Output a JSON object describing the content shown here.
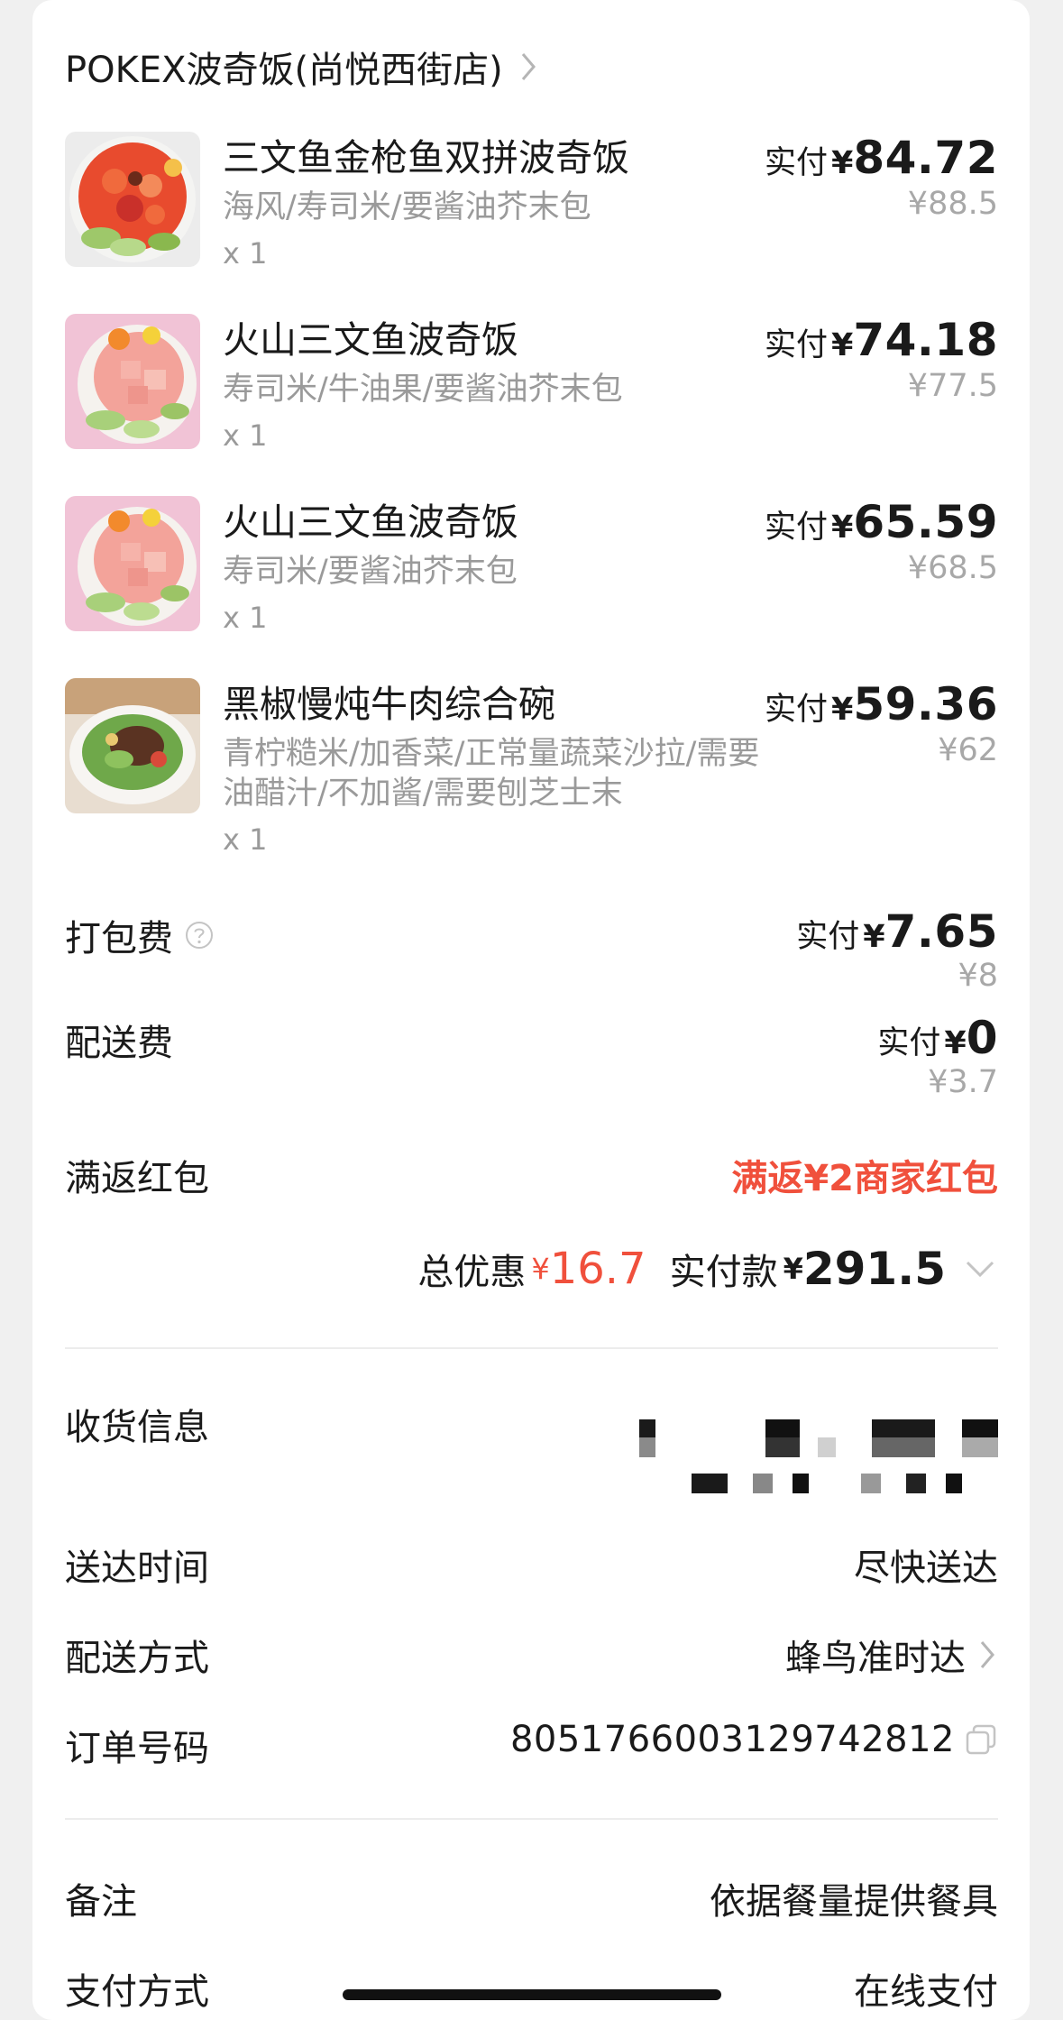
{
  "store": {
    "name": "POKEX波奇饭(尚悦西街店)"
  },
  "items": [
    {
      "name": "三文鱼金枪鱼双拼波奇饭",
      "spec": "海风/寿司米/要酱油芥末包",
      "qty": "x 1",
      "paid_label": "实付",
      "currency": "¥",
      "paid": "84.72",
      "original": "¥88.5",
      "image": "salmon-tuna-poke-bowl"
    },
    {
      "name": "火山三文鱼波奇饭",
      "spec": "寿司米/牛油果/要酱油芥末包",
      "qty": "x 1",
      "paid_label": "实付",
      "currency": "¥",
      "paid": "74.18",
      "original": "¥77.5",
      "image": "volcano-salmon-poke-bowl"
    },
    {
      "name": "火山三文鱼波奇饭",
      "spec": "寿司米/要酱油芥末包",
      "qty": "x 1",
      "paid_label": "实付",
      "currency": "¥",
      "paid": "65.59",
      "original": "¥68.5",
      "image": "volcano-salmon-poke-bowl"
    },
    {
      "name": "黑椒慢炖牛肉综合碗",
      "spec": "青柠糙米/加香菜/正常量蔬菜沙拉/需要油醋汁/不加酱/需要刨芝士末",
      "qty": "x 1",
      "paid_label": "实付",
      "currency": "¥",
      "paid": "59.36",
      "original": "¥62",
      "image": "black-pepper-beef-bowl"
    }
  ],
  "packing_fee": {
    "label": "打包费",
    "paid_label": "实付",
    "currency": "¥",
    "paid": "7.65",
    "original": "¥8"
  },
  "delivery_fee": {
    "label": "配送费",
    "paid_label": "实付",
    "currency": "¥",
    "paid": "0",
    "original": "¥3.7"
  },
  "red_packet": {
    "label": "满返红包",
    "value": "满返¥2商家红包"
  },
  "totals": {
    "discount_label": "总优惠",
    "discount_currency": "¥",
    "discount": "16.7",
    "paid_label": "实付款",
    "paid_currency": "¥",
    "paid": "291.5"
  },
  "details": {
    "receiver_label": "收货信息",
    "delivery_time_label": "送达时间",
    "delivery_time_value": "尽快送达",
    "delivery_method_label": "配送方式",
    "delivery_method_value": "蜂鸟准时达",
    "order_no_label": "订单号码",
    "order_no_value": "8051766003129742812",
    "remark_label": "备注",
    "remark_value": "依据餐量提供餐具",
    "payment_label": "支付方式",
    "payment_value": "在线支付"
  },
  "colors": {
    "accent_red": "#f0503c",
    "text_primary": "#1a1a1a",
    "text_secondary": "#9a9a9a"
  }
}
